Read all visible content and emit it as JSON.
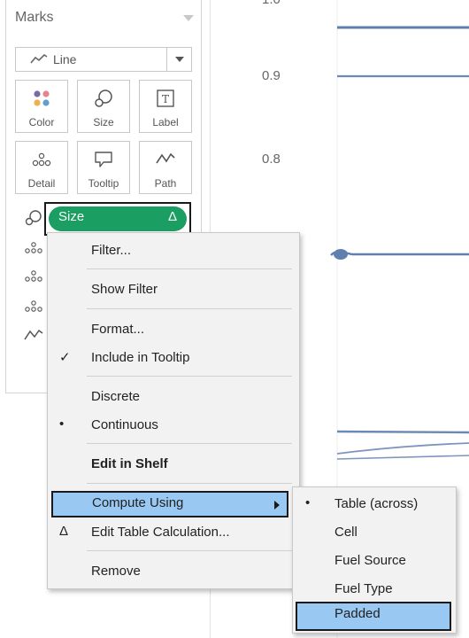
{
  "marks": {
    "title": "Marks",
    "mark_type": "Line",
    "buttons": [
      {
        "label": "Color",
        "icon": "color-icon"
      },
      {
        "label": "Size",
        "icon": "size-icon"
      },
      {
        "label": "Label",
        "icon": "label-icon"
      },
      {
        "label": "Detail",
        "icon": "detail-icon"
      },
      {
        "label": "Tooltip",
        "icon": "tooltip-icon"
      },
      {
        "label": "Path",
        "icon": "path-icon"
      }
    ],
    "size_pill": {
      "label": "Size",
      "badge": "Δ",
      "color": "#1b9e61"
    }
  },
  "chart": {
    "y_ticks": [
      "0.9",
      "0.8"
    ],
    "top_tick_partial": "1.0"
  },
  "context_menu": {
    "items": [
      {
        "label": "Filter...",
        "mark": ""
      },
      {
        "label": "Show Filter",
        "mark": ""
      },
      {
        "label": "Format...",
        "mark": ""
      },
      {
        "label": "Include in Tooltip",
        "mark": "✓"
      },
      {
        "label": "Discrete",
        "mark": ""
      },
      {
        "label": "Continuous",
        "mark": "•"
      },
      {
        "label": "Edit in Shelf",
        "mark": ""
      },
      {
        "label": "Compute Using",
        "mark": ""
      },
      {
        "label": "Edit Table Calculation...",
        "mark": "Δ"
      },
      {
        "label": "Remove",
        "mark": ""
      }
    ],
    "highlight_color": "#99c8f3"
  },
  "submenu": {
    "items": [
      {
        "label": "Table (across)",
        "mark": "•"
      },
      {
        "label": "Cell",
        "mark": ""
      },
      {
        "label": "Fuel Source",
        "mark": ""
      },
      {
        "label": "Fuel Type",
        "mark": ""
      },
      {
        "label": "Padded",
        "mark": ""
      }
    ]
  }
}
